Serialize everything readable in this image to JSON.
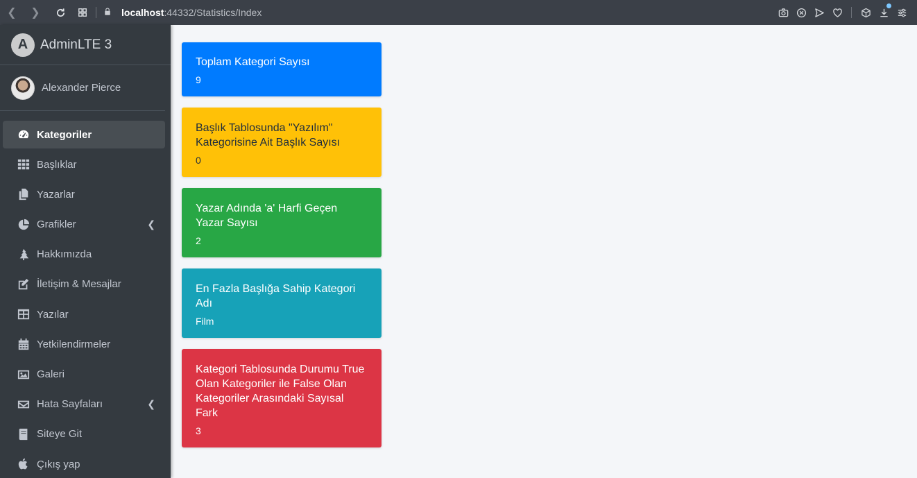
{
  "browser": {
    "url_host": "localhost",
    "url_path": ":44332/Statistics/Index",
    "icons": [
      "back-icon",
      "forward-icon",
      "reload-icon",
      "grid-icon",
      "lock-icon",
      "camera-icon",
      "close-circle-icon",
      "send-icon",
      "heart-icon",
      "cube-icon",
      "download-icon",
      "menu-lines-icon"
    ]
  },
  "sidebar": {
    "brand": "AdminLTE 3",
    "brand_logo_letter": "A",
    "user": "Alexander Pierce",
    "items": [
      {
        "label": "Kategoriler",
        "icon": "dashboard-icon",
        "active": true
      },
      {
        "label": "Başlıklar",
        "icon": "grid-icon"
      },
      {
        "label": "Yazarlar",
        "icon": "copy-icon"
      },
      {
        "label": "Grafikler",
        "icon": "pie-chart-icon",
        "chevron": true
      },
      {
        "label": "Hakkımızda",
        "icon": "tree-icon"
      },
      {
        "label": "İletişim & Mesajlar",
        "icon": "edit-icon"
      },
      {
        "label": "Yazılar",
        "icon": "table-icon"
      },
      {
        "label": "Yetkilendirmeler",
        "icon": "calendar-icon"
      },
      {
        "label": "Galeri",
        "icon": "image-icon"
      },
      {
        "label": "Hata Sayfaları",
        "icon": "envelope-icon",
        "chevron": true
      },
      {
        "label": "Siteye Git",
        "icon": "book-icon"
      },
      {
        "label": "Çıkış yap",
        "icon": "apple-icon"
      }
    ]
  },
  "cards": [
    {
      "title": "Toplam Kategori Sayısı",
      "value": "9",
      "color": "#007bff"
    },
    {
      "title": "Başlık Tablosunda \"Yazılım\" Kategorisine Ait Başlık Sayısı",
      "value": "0",
      "color": "#ffc107"
    },
    {
      "title": "Yazar Adında 'a' Harfi Geçen Yazar Sayısı",
      "value": "2",
      "color": "#28a745"
    },
    {
      "title": "En Fazla Başlığa Sahip Kategori Adı",
      "value": "Film",
      "color": "#17a2b8"
    },
    {
      "title": "Kategori Tablosunda Durumu True Olan Kategoriler ile False Olan Kategoriler Arasındaki Sayısal Fark",
      "value": "3",
      "color": "#dc3545"
    }
  ]
}
